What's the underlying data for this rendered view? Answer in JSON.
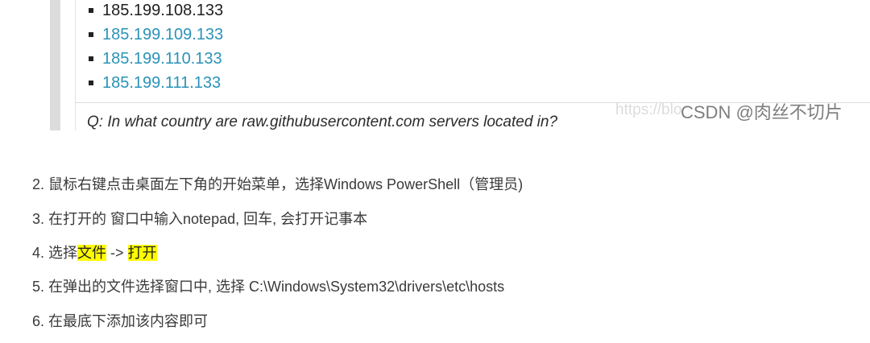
{
  "screenshot": {
    "ips": [
      "185.199.108.133",
      "185.199.109.133",
      "185.199.110.133",
      "185.199.111.133"
    ],
    "question": "Q: In what country are raw.githubusercontent.com servers located in?"
  },
  "watermark": {
    "faint": "https://blo",
    "label": "CSDN @肉丝不切片"
  },
  "steps": [
    {
      "num": "2.",
      "text": "鼠标右键点击桌面左下角的开始菜单，选择Windows PowerShell（管理员)"
    },
    {
      "num": "3.",
      "text": "在打开的 窗口中输入notepad, 回车, 会打开记事本"
    },
    {
      "num": "4.",
      "pre": "选择",
      "hl1": "文件",
      "mid": " -> ",
      "hl2": "打开"
    },
    {
      "num": "5.",
      "text": "在弹出的文件选择窗口中, 选择 C:\\Windows\\System32\\drivers\\etc\\hosts"
    },
    {
      "num": "6.",
      "text": "在最底下添加该内容即可"
    }
  ],
  "colors": {
    "highlight": "#fffb00",
    "link": "#2a93b8"
  }
}
